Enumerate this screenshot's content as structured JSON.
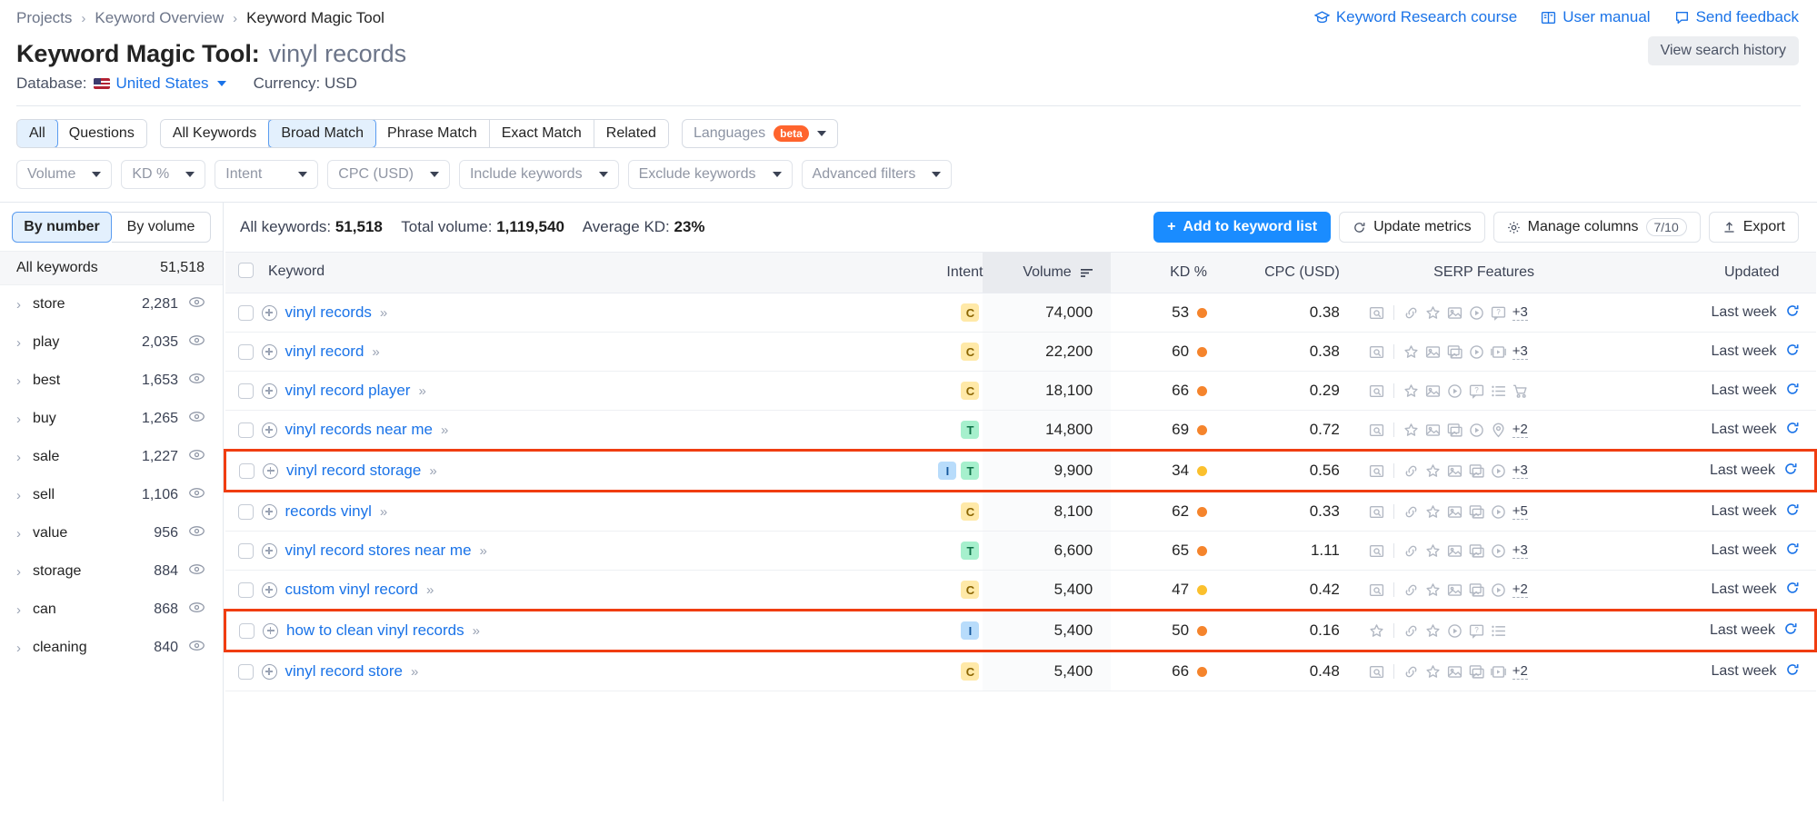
{
  "breadcrumb": {
    "items": [
      "Projects",
      "Keyword Overview",
      "Keyword Magic Tool"
    ],
    "sep": "›"
  },
  "toplinks": [
    {
      "label": "Keyword Research course",
      "icon": "graduation-cap-icon"
    },
    {
      "label": "User manual",
      "icon": "book-icon"
    },
    {
      "label": "Send feedback",
      "icon": "speech-bubble-icon"
    }
  ],
  "header": {
    "title": "Keyword Magic Tool:",
    "keyword": "vinyl records",
    "database_label": "Database:",
    "database_value": "United States",
    "currency_label": "Currency: USD",
    "history_button": "View search history"
  },
  "tabs": {
    "group1": [
      {
        "label": "All",
        "active": true
      },
      {
        "label": "Questions",
        "active": false
      }
    ],
    "group2": [
      {
        "label": "All Keywords",
        "active": false
      },
      {
        "label": "Broad Match",
        "active": true
      },
      {
        "label": "Phrase Match",
        "active": false
      },
      {
        "label": "Exact Match",
        "active": false
      },
      {
        "label": "Related",
        "active": false
      }
    ],
    "languages": {
      "label": "Languages",
      "badge": "beta"
    }
  },
  "filters": [
    "Volume",
    "KD %",
    "Intent",
    "CPC (USD)",
    "Include keywords",
    "Exclude keywords",
    "Advanced filters"
  ],
  "sidebar": {
    "toggle": [
      {
        "label": "By number",
        "active": true
      },
      {
        "label": "By volume",
        "active": false
      }
    ],
    "header": {
      "label": "All keywords",
      "count": "51,518"
    },
    "items": [
      {
        "label": "store",
        "count": "2,281"
      },
      {
        "label": "play",
        "count": "2,035"
      },
      {
        "label": "best",
        "count": "1,653"
      },
      {
        "label": "buy",
        "count": "1,265"
      },
      {
        "label": "sale",
        "count": "1,227"
      },
      {
        "label": "sell",
        "count": "1,106"
      },
      {
        "label": "value",
        "count": "956"
      },
      {
        "label": "storage",
        "count": "884"
      },
      {
        "label": "can",
        "count": "868"
      },
      {
        "label": "cleaning",
        "count": "840"
      }
    ]
  },
  "toolbar": {
    "all_keywords_label": "All keywords:",
    "all_keywords_value": "51,518",
    "total_volume_label": "Total volume:",
    "total_volume_value": "1,119,540",
    "average_kd_label": "Average KD:",
    "average_kd_value": "23%",
    "add_to_list": "Add to keyword list",
    "update_metrics": "Update metrics",
    "manage_columns": "Manage columns",
    "manage_columns_count": "7/10",
    "export": "Export"
  },
  "table": {
    "columns": [
      "Keyword",
      "Intent",
      "Volume",
      "KD %",
      "CPC (USD)",
      "SERP Features",
      "Updated"
    ],
    "sorted_column": "Volume",
    "rows": [
      {
        "keyword": "vinyl records",
        "intent": [
          "C"
        ],
        "volume": "74,000",
        "kd": "53",
        "kd_color": "#f5842c",
        "cpc": "0.38",
        "serp": [
          "search-preview-icon",
          "link-icon",
          "star-icon",
          "image-icon",
          "video-icon",
          "faq-icon"
        ],
        "more": "+3",
        "updated": "Last week"
      },
      {
        "keyword": "vinyl record",
        "intent": [
          "C"
        ],
        "volume": "22,200",
        "kd": "60",
        "kd_color": "#f5842c",
        "cpc": "0.38",
        "serp": [
          "search-preview-icon",
          "star-icon",
          "image-icon",
          "image-pack-icon",
          "video-icon",
          "video-carousel-icon"
        ],
        "more": "+3",
        "updated": "Last week"
      },
      {
        "keyword": "vinyl record player",
        "intent": [
          "C"
        ],
        "volume": "18,100",
        "kd": "66",
        "kd_color": "#f5842c",
        "cpc": "0.29",
        "serp": [
          "search-preview-icon",
          "star-icon",
          "image-icon",
          "video-icon",
          "faq-icon",
          "list-icon",
          "shopping-cart-icon"
        ],
        "more": "",
        "updated": "Last week"
      },
      {
        "keyword": "vinyl records near me",
        "intent": [
          "T"
        ],
        "volume": "14,800",
        "kd": "69",
        "kd_color": "#f5842c",
        "cpc": "0.72",
        "serp": [
          "search-preview-icon",
          "star-icon",
          "image-icon",
          "image-pack-icon",
          "video-icon",
          "location-icon"
        ],
        "more": "+2",
        "updated": "Last week"
      },
      {
        "keyword": "vinyl record storage",
        "intent": [
          "I",
          "T"
        ],
        "volume": "9,900",
        "kd": "34",
        "kd_color": "#fbc02d",
        "cpc": "0.56",
        "serp": [
          "search-preview-icon",
          "link-icon",
          "star-icon",
          "image-icon",
          "image-pack-icon",
          "video-icon"
        ],
        "more": "+3",
        "updated": "Last week",
        "highlight": true
      },
      {
        "keyword": "records vinyl",
        "intent": [
          "C"
        ],
        "volume": "8,100",
        "kd": "62",
        "kd_color": "#f5842c",
        "cpc": "0.33",
        "serp": [
          "search-preview-icon",
          "link-icon",
          "star-icon",
          "image-icon",
          "image-pack-icon",
          "video-icon"
        ],
        "more": "+5",
        "updated": "Last week"
      },
      {
        "keyword": "vinyl record stores near me",
        "intent": [
          "T"
        ],
        "volume": "6,600",
        "kd": "65",
        "kd_color": "#f5842c",
        "cpc": "1.11",
        "serp": [
          "search-preview-icon",
          "link-icon",
          "star-icon",
          "image-icon",
          "image-pack-icon",
          "video-icon"
        ],
        "more": "+3",
        "updated": "Last week"
      },
      {
        "keyword": "custom vinyl record",
        "intent": [
          "C"
        ],
        "volume": "5,400",
        "kd": "47",
        "kd_color": "#fbc02d",
        "cpc": "0.42",
        "serp": [
          "search-preview-icon",
          "link-icon",
          "star-icon",
          "image-icon",
          "image-pack-icon",
          "video-icon"
        ],
        "more": "+2",
        "updated": "Last week"
      },
      {
        "keyword": "how to clean vinyl records",
        "intent": [
          "I"
        ],
        "volume": "5,400",
        "kd": "50",
        "kd_color": "#f5842c",
        "cpc": "0.16",
        "serp": [
          "star-icon",
          "link-icon",
          "star-icon",
          "video-icon",
          "faq-icon",
          "list-icon"
        ],
        "more": "",
        "updated": "Last week",
        "highlight": true
      },
      {
        "keyword": "vinyl record store",
        "intent": [
          "C"
        ],
        "volume": "5,400",
        "kd": "66",
        "kd_color": "#f5842c",
        "cpc": "0.48",
        "serp": [
          "search-preview-icon",
          "link-icon",
          "star-icon",
          "image-icon",
          "image-pack-icon",
          "video-carousel-icon"
        ],
        "more": "+2",
        "updated": "Last week"
      }
    ]
  }
}
